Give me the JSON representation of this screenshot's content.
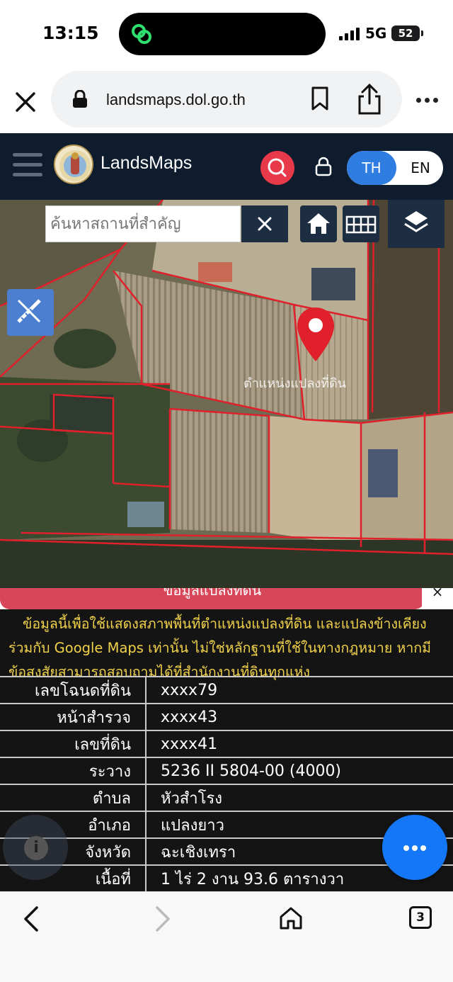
{
  "status_bar": {
    "time": "13:15",
    "network": "5G",
    "battery": "52"
  },
  "browser": {
    "url": "landsmaps.dol.go.th",
    "tab_count": "3"
  },
  "header": {
    "brand": "LandsMaps",
    "lang_th": "TH",
    "lang_en": "EN",
    "active_lang": "TH"
  },
  "map": {
    "search_placeholder": "ค้นหาสถานที่สำคัญ",
    "clear_label": "×",
    "parcel_label": "ตำแหน่งแปลงที่ดิน"
  },
  "info": {
    "banner": "ข้อมูลแปลงที่ดิน",
    "close_label": "×",
    "disclaimer_line1": "ข้อมูลนี้เพื่อใช้แสดงสภาพพื้นที่ตำแหน่งแปลงที่ดิน และแปลงข้างเคียง",
    "disclaimer_line2": "ร่วมกับ Google Maps เท่านั้น ไม่ใช่หลักฐานที่ใช้ในทางกฎหมาย หากมี",
    "disclaimer_line3": "ข้อสงสัยสามารถสอบถามได้ที่สำนักงานที่ดินทุกแห่ง",
    "rows": [
      {
        "key": "เลขโฉนดที่ดิน",
        "value": "xxxx79"
      },
      {
        "key": "หน้าสำรวจ",
        "value": "xxxx43"
      },
      {
        "key": "เลขที่ดิน",
        "value": "xxxx41"
      },
      {
        "key": "ระวาง",
        "value": "5236 II 5804-00 (4000)"
      },
      {
        "key": "ตำบล",
        "value": "หัวสำโรง"
      },
      {
        "key": "อำเภอ",
        "value": "แปลงยาว"
      },
      {
        "key": "จังหวัด",
        "value": "ฉะเชิงเทรา"
      },
      {
        "key": "เนื้อที่",
        "value": "1 ไร่ 2 งาน 93.6 ตารางวา"
      }
    ],
    "info_icon_label": "i"
  },
  "colors": {
    "header_bg": "#0f1c2e",
    "accent_blue": "#2f7de1",
    "search_red": "#e8394b",
    "banner_red": "#d8465a",
    "disclaimer_yellow": "#f1d24a",
    "parcel_line": "#e0202a"
  }
}
